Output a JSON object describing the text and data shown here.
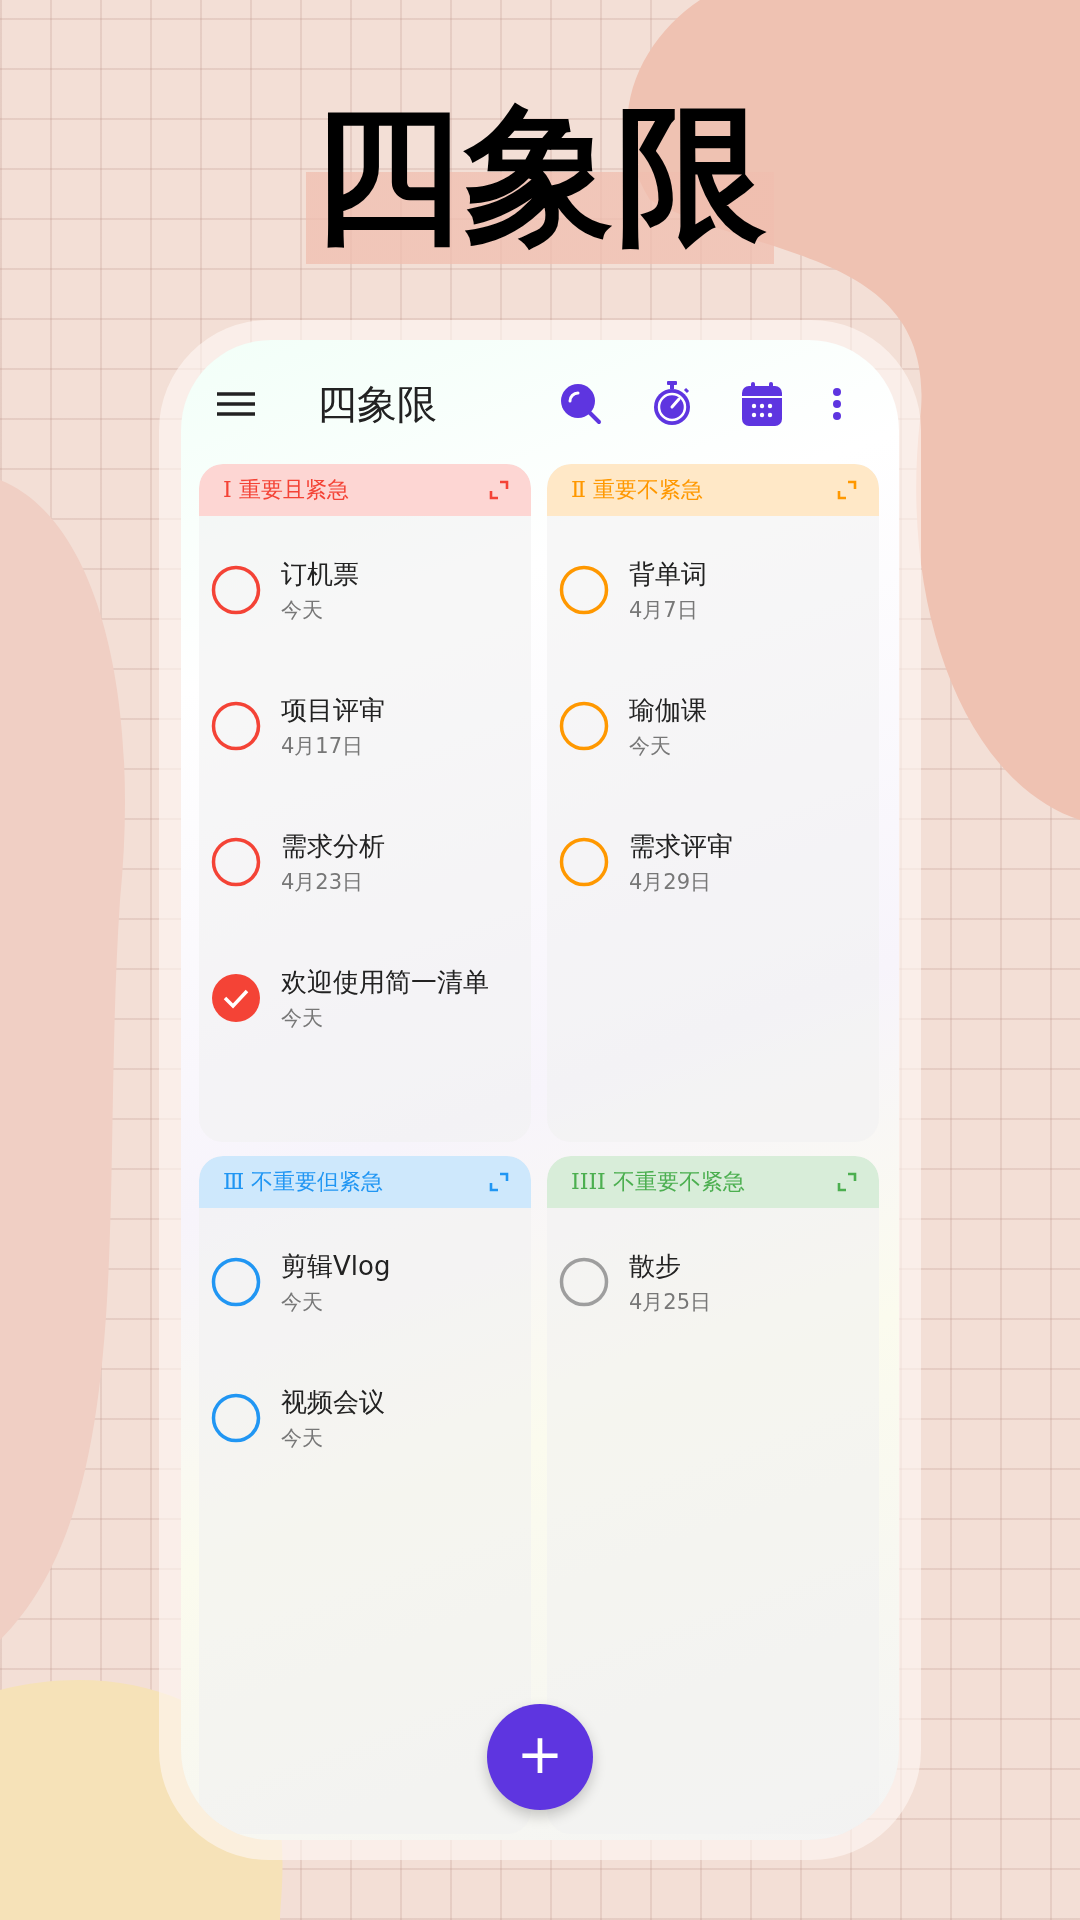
{
  "headline": "四象限",
  "app_bar": {
    "title": "四象限"
  },
  "quadrants": [
    {
      "numeral": "Ⅰ",
      "label": "重要且紧急",
      "color": "#f44336",
      "tasks": [
        {
          "title": "订机票",
          "date": "今天",
          "checked": false,
          "color": "#f44336"
        },
        {
          "title": "项目评审",
          "date": "4月17日",
          "checked": false,
          "color": "#f44336"
        },
        {
          "title": "需求分析",
          "date": "4月23日",
          "checked": false,
          "color": "#f44336"
        },
        {
          "title": "欢迎使用简一清单",
          "date": "今天",
          "checked": true,
          "color": "#f44336"
        }
      ]
    },
    {
      "numeral": "Ⅱ",
      "label": "重要不紧急",
      "color": "#ff9800",
      "tasks": [
        {
          "title": "背单词",
          "date": "4月7日",
          "checked": false,
          "color": "#ff9800"
        },
        {
          "title": "瑜伽课",
          "date": "今天",
          "checked": false,
          "color": "#ff9800"
        },
        {
          "title": "需求评审",
          "date": "4月29日",
          "checked": false,
          "color": "#ff9800"
        }
      ]
    },
    {
      "numeral": "Ⅲ",
      "label": "不重要但紧急",
      "color": "#2196f3",
      "tasks": [
        {
          "title": "剪辑Vlog",
          "date": "今天",
          "checked": false,
          "color": "#2196f3"
        },
        {
          "title": "视频会议",
          "date": "今天",
          "checked": false,
          "color": "#2196f3"
        }
      ]
    },
    {
      "numeral": "IIII",
      "label": "不重要不紧急",
      "color": "#4caf50",
      "tasks": [
        {
          "title": "散步",
          "date": "4月25日",
          "checked": false,
          "color": "#9e9e9e"
        }
      ]
    }
  ],
  "fab": "+"
}
